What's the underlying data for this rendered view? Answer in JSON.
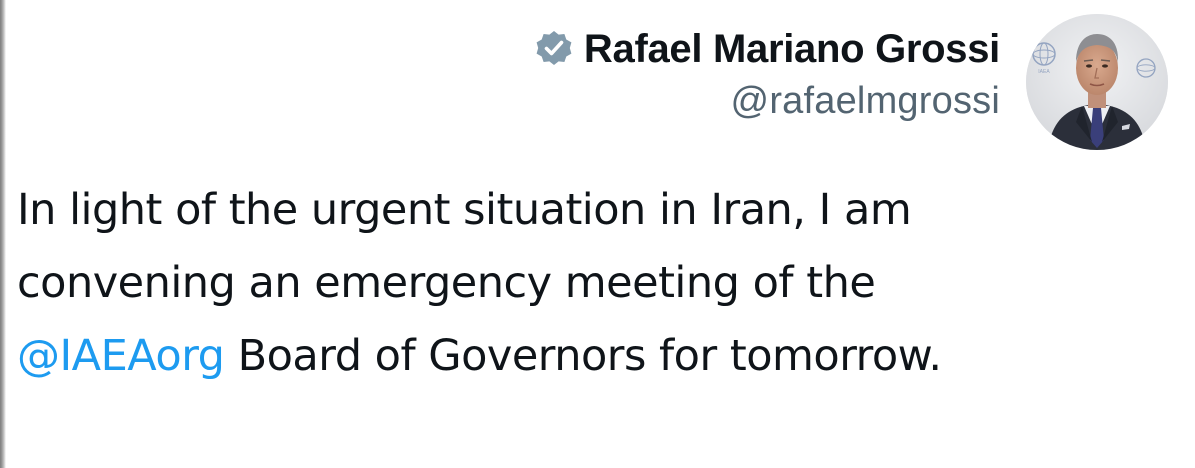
{
  "tweet": {
    "author": {
      "display_name": "Rafael Mariano Grossi",
      "handle": "@rafaelmgrossi",
      "verified_icon": "verified-badge-icon",
      "verified_color": "#829aab",
      "avatar_logo_text": "IAEA"
    },
    "text": {
      "line1": "In light of the urgent situation in Iran, I am",
      "line2": "convening an emergency meeting of the",
      "mention": "@IAEAorg",
      "line3_rest": " Board of Governors for tomorrow."
    },
    "colors": {
      "text": "#0f1419",
      "handle": "#536471",
      "mention": "#1d9bf0",
      "background": "#ffffff"
    }
  }
}
